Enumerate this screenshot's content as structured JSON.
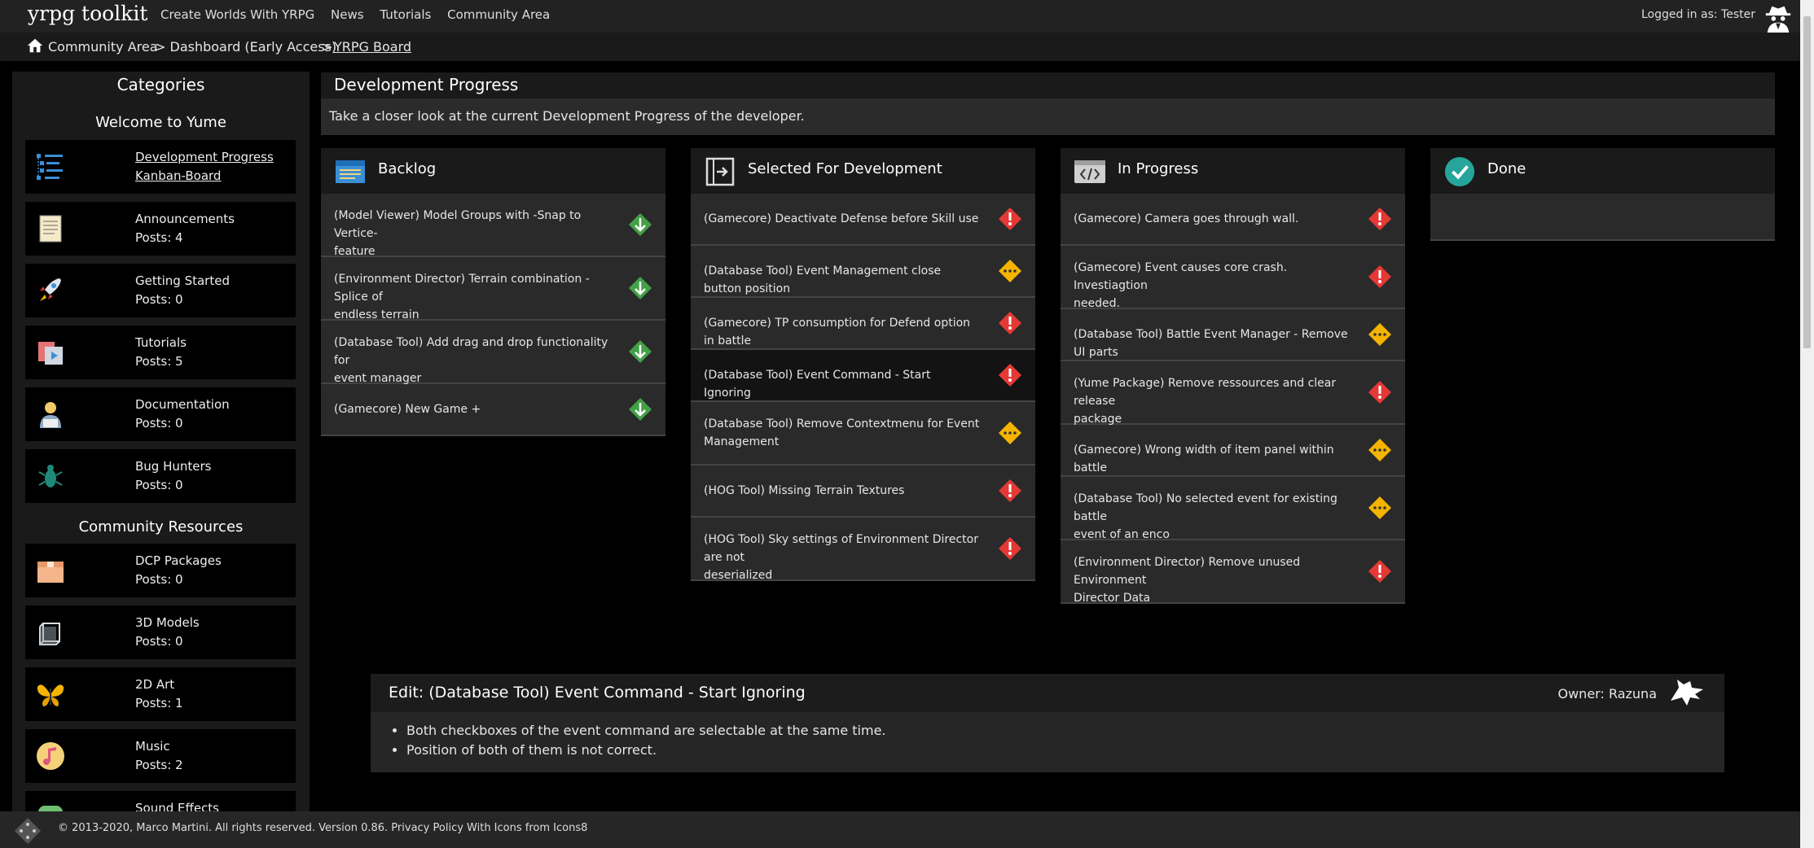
{
  "nav": {
    "brand": "yrpg toolkit",
    "links": [
      "Create Worlds With YRPG",
      "News",
      "Tutorials",
      "Community Area"
    ],
    "login": "Logged in as: Tester",
    "user_icon": "spy-icon"
  },
  "breadcrumb": {
    "home_icon": "home-icon",
    "items": [
      "Community Area",
      "> Dashboard (Early Access)",
      ">",
      "YRPG Board"
    ]
  },
  "sidebar": {
    "title": "Categories",
    "section1": "Welcome to Yume",
    "section2": "Community Resources",
    "items": [
      {
        "line1": "Development Progress",
        "line2": "Kanban-Board",
        "icon": "kanban-icon"
      },
      {
        "line1": "Announcements",
        "line2": "Posts: 4",
        "icon": "document-icon"
      },
      {
        "line1": "Getting Started",
        "line2": "Posts: 0",
        "icon": "rocket-icon"
      },
      {
        "line1": "Tutorials",
        "line2": "Posts: 5",
        "icon": "tutorial-icon"
      },
      {
        "line1": "Documentation",
        "line2": "Posts: 0",
        "icon": "reader-icon"
      },
      {
        "line1": "Bug Hunters",
        "line2": "Posts: 0",
        "icon": "bug-icon"
      },
      {
        "line1": "DCP Packages",
        "line2": "Posts: 0",
        "icon": "box-icon"
      },
      {
        "line1": "3D Models",
        "line2": "Posts: 0",
        "icon": "cube-icon"
      },
      {
        "line1": "2D Art",
        "line2": "Posts: 1",
        "icon": "butterfly-icon"
      },
      {
        "line1": "Music",
        "line2": "Posts: 2",
        "icon": "music-icon"
      },
      {
        "line1": "Sound Effects",
        "line2": "",
        "icon": "sound-icon"
      }
    ]
  },
  "main": {
    "title": "Development Progress",
    "subtitle": "Take a closer look at the current Development Progress of the developer."
  },
  "columns": [
    {
      "title": "Backlog",
      "icon": "backlog-icon",
      "items": [
        {
          "lines": [
            "(Model Viewer) Model Groups with -Snap to Vertice-",
            "feature"
          ],
          "status": "low"
        },
        {
          "lines": [
            "(Environment Director) Terrain combination - Splice of",
            "endless terrain"
          ],
          "status": "low"
        },
        {
          "lines": [
            "(Database Tool) Add drag and drop functionality for",
            "event manager"
          ],
          "status": "low"
        },
        {
          "lines": [
            "(Gamecore) New Game +"
          ],
          "status": "low"
        }
      ]
    },
    {
      "title": "Selected For Development",
      "icon": "selected-icon",
      "items": [
        {
          "lines": [
            "(Gamecore) Deactivate Defense before Skill use"
          ],
          "status": "high"
        },
        {
          "lines": [
            "(Database Tool) Event Management close button position"
          ],
          "status": "medium"
        },
        {
          "lines": [
            "(Gamecore) TP consumption for Defend option in battle"
          ],
          "status": "high"
        },
        {
          "lines": [
            "(Database Tool) Event Command - Start Ignoring"
          ],
          "status": "high"
        },
        {
          "lines": [
            "(Database Tool) Remove Contextmenu for Event",
            "Management"
          ],
          "status": "medium"
        },
        {
          "lines": [
            "(HOG Tool) Missing Terrain Textures"
          ],
          "status": "high"
        },
        {
          "lines": [
            "(HOG Tool) Sky settings of Environment Director are not",
            "deserialized"
          ],
          "status": "high"
        }
      ]
    },
    {
      "title": "In Progress",
      "icon": "code-icon",
      "items": [
        {
          "lines": [
            "(Gamecore) Camera goes through wall."
          ],
          "status": "high"
        },
        {
          "lines": [
            "(Gamecore) Event causes core crash. Investiagtion",
            "needed."
          ],
          "status": "high"
        },
        {
          "lines": [
            "(Database Tool) Battle Event Manager - Remove UI parts"
          ],
          "status": "medium"
        },
        {
          "lines": [
            "(Yume Package) Remove ressources and clear release",
            "package"
          ],
          "status": "high"
        },
        {
          "lines": [
            "(Gamecore) Wrong width of item panel within battle"
          ],
          "status": "medium"
        },
        {
          "lines": [
            "(Database Tool) No selected event for existing battle",
            "event of an enco"
          ],
          "status": "medium"
        },
        {
          "lines": [
            "(Environment Director) Remove unused Environment",
            "Director Data"
          ],
          "status": "high"
        }
      ]
    },
    {
      "title": "Done",
      "icon": "check-icon",
      "items": []
    }
  ],
  "edit": {
    "title": "Edit: (Database Tool) Event Command - Start Ignoring",
    "owner": "Owner: Razuna",
    "bullets": [
      "Both checkboxes of the event command are selectable at the same time.",
      "Position of both of them is not correct."
    ]
  },
  "footer": {
    "text": "© 2013-2020, Marco Martini. All rights reserved. Version 0.86. Privacy Policy With Icons from Icons8"
  },
  "colors": {
    "high": "#e53935",
    "medium": "#f4b400",
    "low": "#43a047",
    "done": "#26a69a"
  }
}
